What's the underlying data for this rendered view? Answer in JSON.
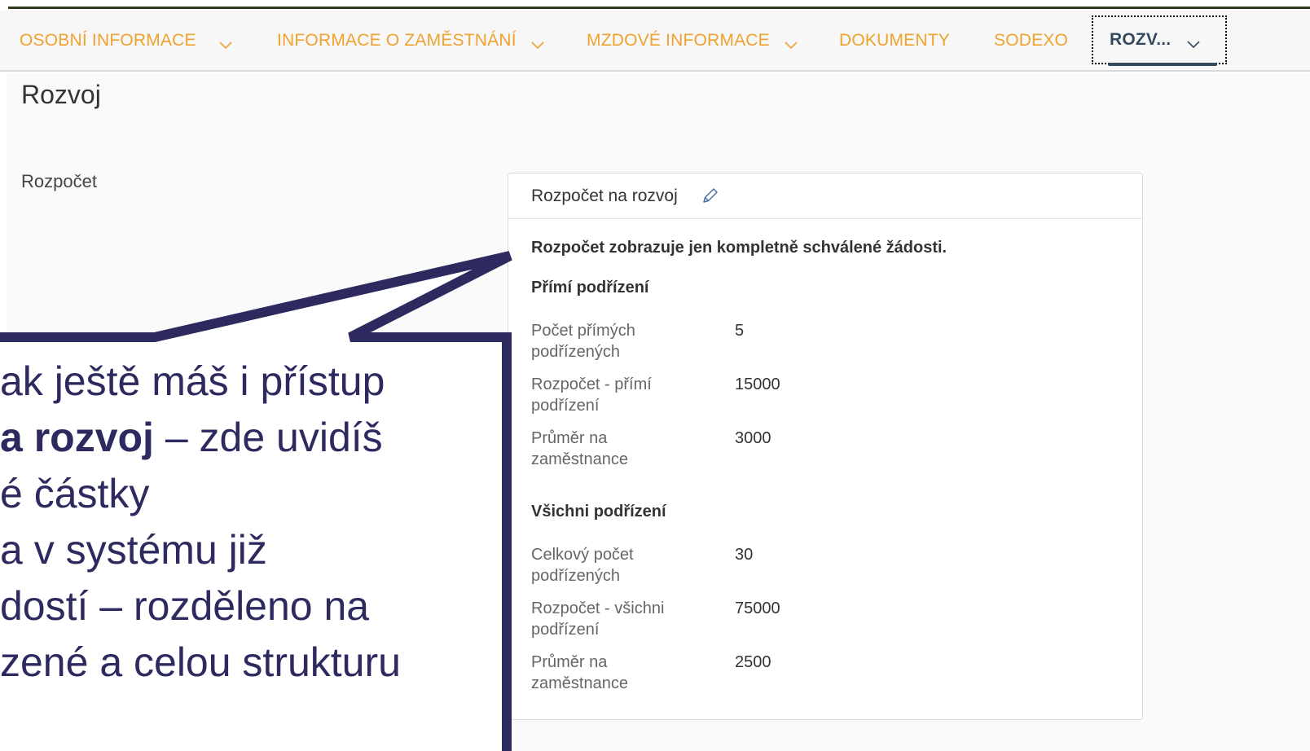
{
  "nav": {
    "items": [
      {
        "label": "OSOBNÍ INFORMACE",
        "has_chevron": true
      },
      {
        "label": "INFORMACE O ZAMĚSTNÁNÍ",
        "has_chevron": true
      },
      {
        "label": "MZDOVÉ INFORMACE",
        "has_chevron": true
      },
      {
        "label": "DOKUMENTY",
        "has_chevron": false
      },
      {
        "label": "SODEXO",
        "has_chevron": false
      },
      {
        "label": "ROZV...",
        "has_chevron": true,
        "active": true
      }
    ],
    "inactive_color": "#f0a22e",
    "active_color": "#354a5f"
  },
  "page": {
    "title": "Rozvoj",
    "section_label": "Rozpočet"
  },
  "card": {
    "header": "Rozpočet na rozvoj",
    "header_icon": "pencil-icon",
    "note": "Rozpočet zobrazuje jen kompletně schválené žádosti.",
    "direct": {
      "title": "Přímí podřízení",
      "rows": [
        {
          "label_1": "Počet přímých",
          "label_2": "podřízených",
          "value": "5"
        },
        {
          "label_1": "Rozpočet - přímí",
          "label_2": "podřízení",
          "value": "15000"
        },
        {
          "label_1": "Průměr na",
          "label_2": "zaměstnance",
          "value": "3000"
        }
      ]
    },
    "all": {
      "title": "Všichni podřízení",
      "rows": [
        {
          "label_1": "Celkový počet",
          "label_2": "podřízených",
          "value": "30"
        },
        {
          "label_1": "Rozpočet - všichni",
          "label_2": "podřízení",
          "value": "75000"
        },
        {
          "label_1": "Průměr na",
          "label_2": "zaměstnance",
          "value": "2500"
        }
      ]
    }
  },
  "callout": {
    "line1": "ak ještě máš i přístup",
    "line2_bold": "a rozvoj",
    "line2_rest": " – zde uvidíš",
    "line3": "é částky",
    "line4": " a v systému již",
    "line5": "dostí – rozděleno na",
    "line6": "zené a celou strukturu",
    "color": "#2c2a5e"
  }
}
